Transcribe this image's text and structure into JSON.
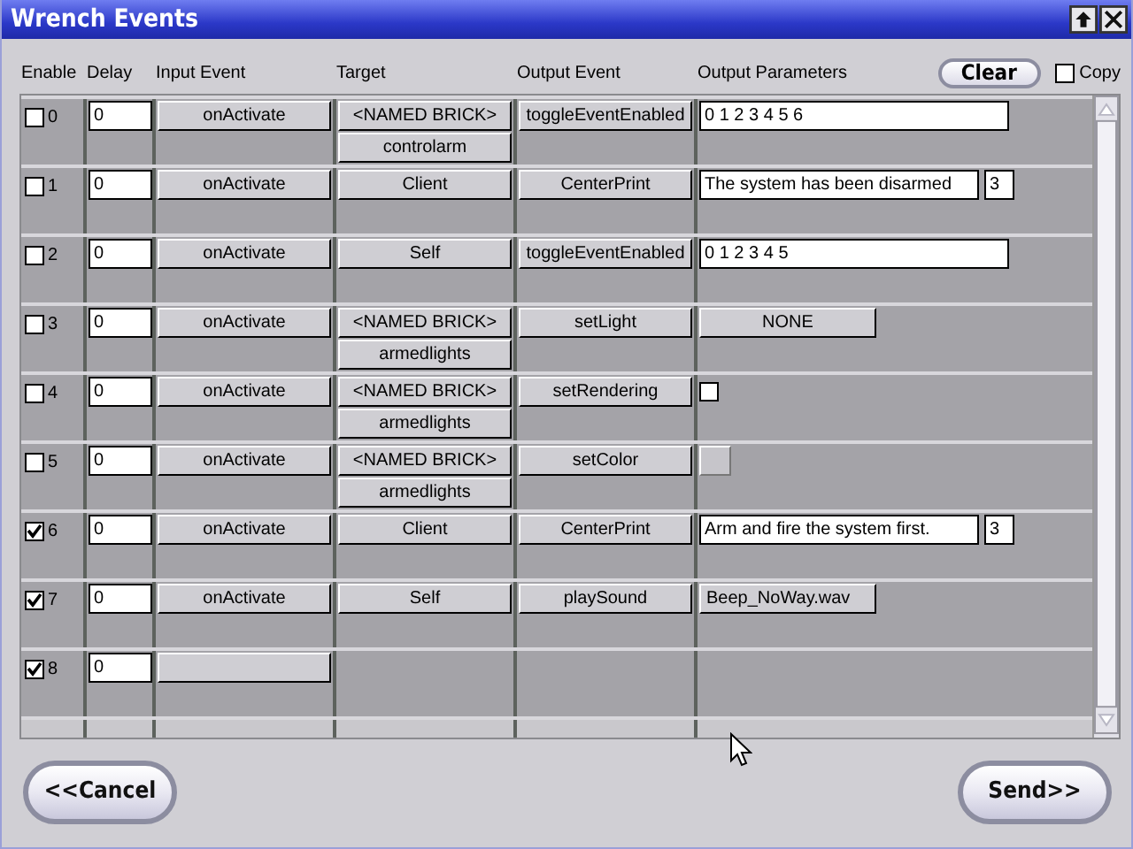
{
  "window": {
    "title": "Wrench Events"
  },
  "columns": [
    "Enable",
    "Delay",
    "Input Event",
    "Target",
    "Output Event",
    "Output Parameters"
  ],
  "clear_button": "Clear",
  "copy": {
    "label": "Copy",
    "checked": false
  },
  "events": [
    {
      "index": "0",
      "enabled": false,
      "delay": "0",
      "input_event": "onActivate",
      "target": "<NAMED BRICK>",
      "target_name": "controlarm",
      "output_event": "toggleEventEnabled",
      "params": [
        {
          "kind": "text",
          "value": "0 1 2 3 4 5 6"
        }
      ]
    },
    {
      "index": "1",
      "enabled": false,
      "delay": "0",
      "input_event": "onActivate",
      "target": "Client",
      "output_event": "CenterPrint",
      "params": [
        {
          "kind": "message",
          "value": "The system has been disarmed"
        },
        {
          "kind": "count",
          "value": "3"
        }
      ]
    },
    {
      "index": "2",
      "enabled": false,
      "delay": "0",
      "input_event": "onActivate",
      "target": "Self",
      "output_event": "toggleEventEnabled",
      "params": [
        {
          "kind": "text",
          "value": "0 1 2 3 4 5"
        }
      ]
    },
    {
      "index": "3",
      "enabled": false,
      "delay": "0",
      "input_event": "onActivate",
      "target": "<NAMED BRICK>",
      "target_name": "armedlights",
      "output_event": "setLight",
      "params": [
        {
          "kind": "button",
          "value": "NONE"
        }
      ]
    },
    {
      "index": "4",
      "enabled": false,
      "delay": "0",
      "input_event": "onActivate",
      "target": "<NAMED BRICK>",
      "target_name": "armedlights",
      "output_event": "setRendering",
      "params": [
        {
          "kind": "checkbox",
          "checked": false
        }
      ]
    },
    {
      "index": "5",
      "enabled": false,
      "delay": "0",
      "input_event": "onActivate",
      "target": "<NAMED BRICK>",
      "target_name": "armedlights",
      "output_event": "setColor",
      "params": [
        {
          "kind": "swatch"
        }
      ]
    },
    {
      "index": "6",
      "enabled": true,
      "delay": "0",
      "input_event": "onActivate",
      "target": "Client",
      "output_event": "CenterPrint",
      "params": [
        {
          "kind": "message",
          "value": "Arm and fire the system first."
        },
        {
          "kind": "count",
          "value": "3"
        }
      ]
    },
    {
      "index": "7",
      "enabled": true,
      "delay": "0",
      "input_event": "onActivate",
      "target": "Self",
      "output_event": "playSound",
      "params": [
        {
          "kind": "filebutton",
          "value": "Beep_NoWay.wav"
        }
      ]
    },
    {
      "index": "8",
      "enabled": true,
      "delay": "0"
    }
  ],
  "cancel_button": "<<Cancel",
  "send_button": "Send>>"
}
